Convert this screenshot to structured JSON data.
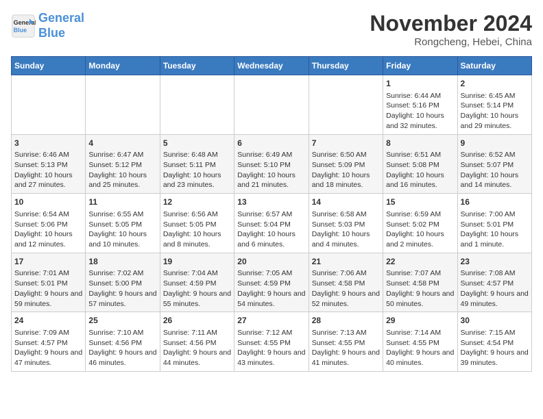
{
  "header": {
    "logo_line1": "General",
    "logo_line2": "Blue",
    "month": "November 2024",
    "location": "Rongcheng, Hebei, China"
  },
  "days_of_week": [
    "Sunday",
    "Monday",
    "Tuesday",
    "Wednesday",
    "Thursday",
    "Friday",
    "Saturday"
  ],
  "weeks": [
    {
      "days": [
        {
          "num": "",
          "empty": true
        },
        {
          "num": "",
          "empty": true
        },
        {
          "num": "",
          "empty": true
        },
        {
          "num": "",
          "empty": true
        },
        {
          "num": "",
          "empty": true
        },
        {
          "num": "1",
          "sunrise": "6:44 AM",
          "sunset": "5:16 PM",
          "daylight": "10 hours and 32 minutes."
        },
        {
          "num": "2",
          "sunrise": "6:45 AM",
          "sunset": "5:14 PM",
          "daylight": "10 hours and 29 minutes."
        }
      ]
    },
    {
      "days": [
        {
          "num": "3",
          "sunrise": "6:46 AM",
          "sunset": "5:13 PM",
          "daylight": "10 hours and 27 minutes."
        },
        {
          "num": "4",
          "sunrise": "6:47 AM",
          "sunset": "5:12 PM",
          "daylight": "10 hours and 25 minutes."
        },
        {
          "num": "5",
          "sunrise": "6:48 AM",
          "sunset": "5:11 PM",
          "daylight": "10 hours and 23 minutes."
        },
        {
          "num": "6",
          "sunrise": "6:49 AM",
          "sunset": "5:10 PM",
          "daylight": "10 hours and 21 minutes."
        },
        {
          "num": "7",
          "sunrise": "6:50 AM",
          "sunset": "5:09 PM",
          "daylight": "10 hours and 18 minutes."
        },
        {
          "num": "8",
          "sunrise": "6:51 AM",
          "sunset": "5:08 PM",
          "daylight": "10 hours and 16 minutes."
        },
        {
          "num": "9",
          "sunrise": "6:52 AM",
          "sunset": "5:07 PM",
          "daylight": "10 hours and 14 minutes."
        }
      ]
    },
    {
      "days": [
        {
          "num": "10",
          "sunrise": "6:54 AM",
          "sunset": "5:06 PM",
          "daylight": "10 hours and 12 minutes."
        },
        {
          "num": "11",
          "sunrise": "6:55 AM",
          "sunset": "5:05 PM",
          "daylight": "10 hours and 10 minutes."
        },
        {
          "num": "12",
          "sunrise": "6:56 AM",
          "sunset": "5:05 PM",
          "daylight": "10 hours and 8 minutes."
        },
        {
          "num": "13",
          "sunrise": "6:57 AM",
          "sunset": "5:04 PM",
          "daylight": "10 hours and 6 minutes."
        },
        {
          "num": "14",
          "sunrise": "6:58 AM",
          "sunset": "5:03 PM",
          "daylight": "10 hours and 4 minutes."
        },
        {
          "num": "15",
          "sunrise": "6:59 AM",
          "sunset": "5:02 PM",
          "daylight": "10 hours and 2 minutes."
        },
        {
          "num": "16",
          "sunrise": "7:00 AM",
          "sunset": "5:01 PM",
          "daylight": "10 hours and 1 minute."
        }
      ]
    },
    {
      "days": [
        {
          "num": "17",
          "sunrise": "7:01 AM",
          "sunset": "5:01 PM",
          "daylight": "9 hours and 59 minutes."
        },
        {
          "num": "18",
          "sunrise": "7:02 AM",
          "sunset": "5:00 PM",
          "daylight": "9 hours and 57 minutes."
        },
        {
          "num": "19",
          "sunrise": "7:04 AM",
          "sunset": "4:59 PM",
          "daylight": "9 hours and 55 minutes."
        },
        {
          "num": "20",
          "sunrise": "7:05 AM",
          "sunset": "4:59 PM",
          "daylight": "9 hours and 54 minutes."
        },
        {
          "num": "21",
          "sunrise": "7:06 AM",
          "sunset": "4:58 PM",
          "daylight": "9 hours and 52 minutes."
        },
        {
          "num": "22",
          "sunrise": "7:07 AM",
          "sunset": "4:58 PM",
          "daylight": "9 hours and 50 minutes."
        },
        {
          "num": "23",
          "sunrise": "7:08 AM",
          "sunset": "4:57 PM",
          "daylight": "9 hours and 49 minutes."
        }
      ]
    },
    {
      "days": [
        {
          "num": "24",
          "sunrise": "7:09 AM",
          "sunset": "4:57 PM",
          "daylight": "9 hours and 47 minutes."
        },
        {
          "num": "25",
          "sunrise": "7:10 AM",
          "sunset": "4:56 PM",
          "daylight": "9 hours and 46 minutes."
        },
        {
          "num": "26",
          "sunrise": "7:11 AM",
          "sunset": "4:56 PM",
          "daylight": "9 hours and 44 minutes."
        },
        {
          "num": "27",
          "sunrise": "7:12 AM",
          "sunset": "4:55 PM",
          "daylight": "9 hours and 43 minutes."
        },
        {
          "num": "28",
          "sunrise": "7:13 AM",
          "sunset": "4:55 PM",
          "daylight": "9 hours and 41 minutes."
        },
        {
          "num": "29",
          "sunrise": "7:14 AM",
          "sunset": "4:55 PM",
          "daylight": "9 hours and 40 minutes."
        },
        {
          "num": "30",
          "sunrise": "7:15 AM",
          "sunset": "4:54 PM",
          "daylight": "9 hours and 39 minutes."
        }
      ]
    }
  ]
}
